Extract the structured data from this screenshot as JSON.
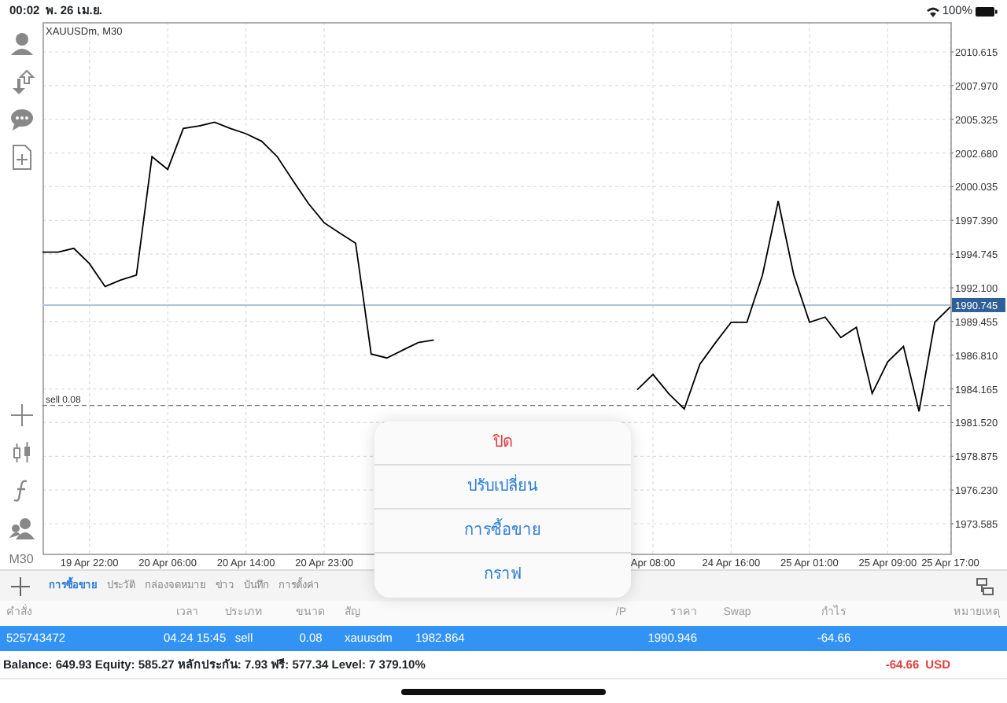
{
  "status_bar": {
    "time": "00:02",
    "date": "พ. 26 เม.ย.",
    "battery": "100%"
  },
  "toolbar": {
    "timeframe": "M30"
  },
  "chart": {
    "chart_data": {
      "type": "line",
      "title": "XAUUSDm, M30",
      "grid": true,
      "ylim": [
        1971.24,
        2012.96
      ],
      "categories": [
        null,
        null,
        null,
        "19 Apr 22:00",
        null,
        null,
        null,
        null,
        "20 Apr 06:00",
        null,
        null,
        null,
        null,
        "20 Apr 14:00",
        null,
        null,
        null,
        null,
        "20 Apr 23:00",
        null,
        null,
        null,
        null,
        null,
        null,
        null,
        null,
        null,
        null,
        null,
        null,
        null,
        null,
        null,
        null,
        null,
        null,
        null,
        null,
        "Apr 08:00",
        null,
        null,
        null,
        null,
        "24 Apr 16:00",
        null,
        null,
        null,
        null,
        "25 Apr 01:00",
        null,
        null,
        null,
        null,
        "25 Apr 09:00",
        null,
        null,
        null,
        "25 Apr 17:00"
      ],
      "yticks": [
        {
          "value": 1973.585,
          "label": "1973.585"
        },
        {
          "value": 1976.23,
          "label": "1976.230"
        },
        {
          "value": 1978.875,
          "label": "1978.875"
        },
        {
          "value": 1981.52,
          "label": "1981.520"
        },
        {
          "value": 1984.165,
          "label": "1984.165"
        },
        {
          "value": 1986.81,
          "label": "1986.810"
        },
        {
          "value": 1989.455,
          "label": "1989.455"
        },
        {
          "value": 1992.1,
          "label": "1992.100"
        },
        {
          "value": 1994.745,
          "label": "1994.745"
        },
        {
          "value": 1997.39,
          "label": "1997.390"
        },
        {
          "value": 2000.035,
          "label": "2000.035"
        },
        {
          "value": 2002.68,
          "label": "2002.680"
        },
        {
          "value": 2005.325,
          "label": "2005.325"
        },
        {
          "value": 2007.97,
          "label": "2007.970"
        },
        {
          "value": 2010.615,
          "label": "2010.615"
        }
      ],
      "series": [
        {
          "color": "#000000",
          "values": [
            1994.9,
            1994.9,
            1995.2,
            1994.0,
            1992.2,
            1992.7,
            1993.1,
            2002.4,
            2001.4,
            2004.6,
            2004.8,
            2005.1,
            2004.6,
            2004.2,
            2003.6,
            2002.4,
            2000.5,
            1998.7,
            1997.2,
            1996.4,
            1995.6,
            1986.9,
            1986.6,
            1987.2,
            1987.8,
            1988.0,
            null,
            null,
            null,
            null,
            null,
            null,
            null,
            null,
            null,
            null,
            null,
            null,
            1984.1,
            1985.3,
            1983.8,
            1982.6,
            1986.1,
            1987.8,
            1989.4,
            1989.4,
            1993.1,
            1998.9,
            1993.1,
            1989.4,
            1989.8,
            1988.2,
            1989.0,
            1983.8,
            1986.3,
            1987.5,
            1982.4,
            1989.4,
            1990.6
          ]
        }
      ],
      "ref_lines": [
        {
          "axis": "y",
          "value": 1982.864,
          "label": "sell 0.08"
        },
        {
          "axis": "y",
          "value": 1990.745,
          "label": "1990.745"
        }
      ]
    }
  },
  "tabs": [
    {
      "label": "การซื้อขาย",
      "selected": true
    },
    {
      "label": "ประวัติ",
      "selected": false
    },
    {
      "label": "กล่องจดหมาย",
      "selected": false
    },
    {
      "label": "ข่าว",
      "selected": false
    },
    {
      "label": "บันทึก",
      "selected": false
    },
    {
      "label": "การตั้งค่า",
      "selected": false
    }
  ],
  "table": {
    "columns": [
      "คำสั่ง",
      "เวลา",
      "ประเภท",
      "ขนาด",
      "สัญ",
      null,
      null,
      "/P",
      "ราคา",
      "Swap",
      "กำไร",
      "หมายเหตุ"
    ],
    "rows": [
      {
        "selected": true,
        "cells": [
          "525743472",
          "04.24 15:45",
          "sell",
          "0.08",
          "xauusdm",
          "1982.864",
          null,
          null,
          "1990.946",
          null,
          "-64.66",
          null
        ]
      }
    ]
  },
  "summary": {
    "text": "Balance: 649.93 Equity: 585.27 หลักประกัน: 7.93 ฟรี: 577.34 Level: 7 379.10%",
    "profit": "-64.66",
    "currency": "USD"
  },
  "action_menu": [
    {
      "label": "ปิด",
      "kind": "destructive"
    },
    {
      "label": "ปรับเปลี่ยน",
      "kind": "default"
    },
    {
      "label": "การซื้อขาย",
      "kind": "default"
    },
    {
      "label": "กราฟ",
      "kind": "default"
    }
  ]
}
